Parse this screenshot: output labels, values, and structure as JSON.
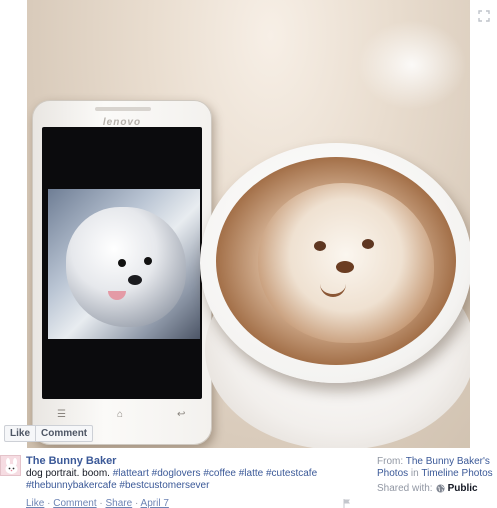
{
  "photo": {
    "phone_brand": "lenovo",
    "phone_keys": {
      "menu": "☰",
      "home": "⌂",
      "back": "↩"
    }
  },
  "photo_actions": {
    "like_label": "Like",
    "comment_label": "Comment"
  },
  "post": {
    "page_name": "The Bunny Baker",
    "caption_text": "dog portrait. boom.",
    "hashtags": [
      "#latteart",
      "#doglovers",
      "#coffee",
      "#latte",
      "#cutestcafe",
      "#thebunnybakercafe",
      "#bestcustomersever"
    ],
    "actions": {
      "like": "Like",
      "comment": "Comment",
      "share": "Share",
      "date": "April 7"
    }
  },
  "sidebar": {
    "from_label": "From:",
    "from_page": "The Bunny Baker's",
    "photos_link": "Photos",
    "in_label": "in",
    "album": "Timeline Photos",
    "shared_with_label": "Shared with:",
    "privacy": "Public"
  },
  "colors": {
    "link": "#3b5998",
    "muted": "#9197a3",
    "text": "#141823"
  }
}
